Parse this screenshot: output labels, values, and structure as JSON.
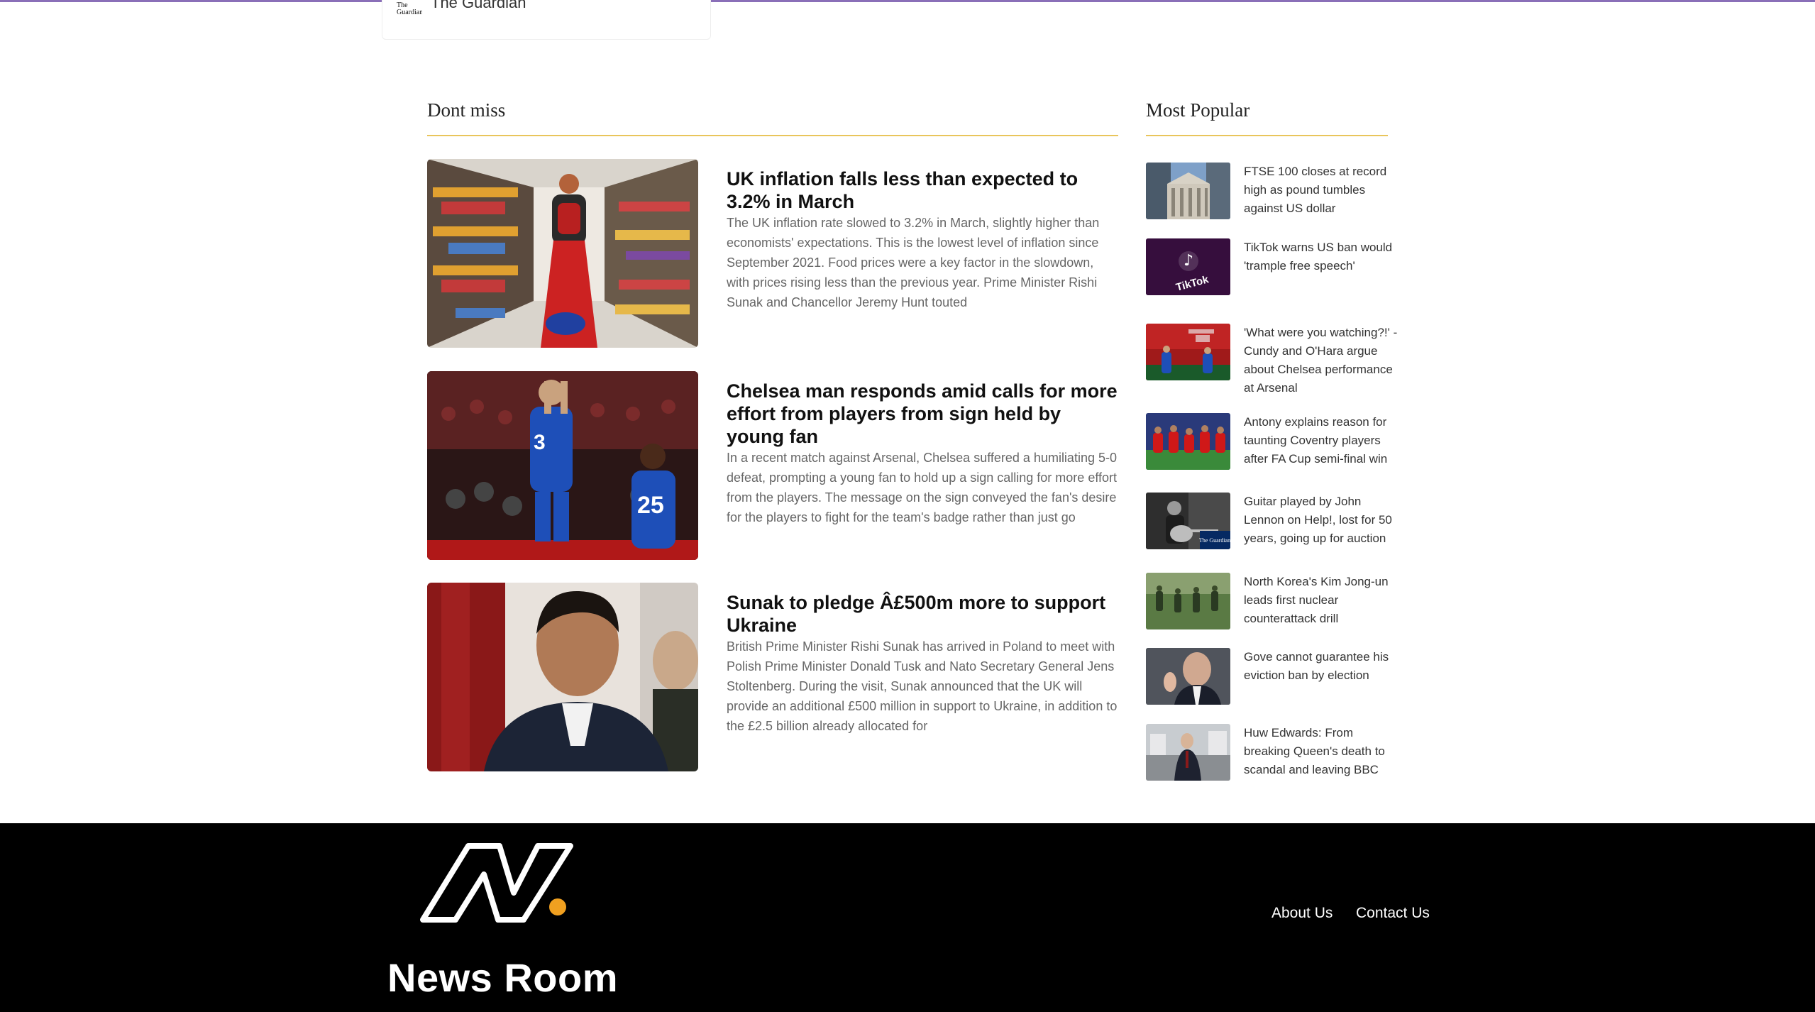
{
  "top_card": {
    "source_name": "The Guardian",
    "logo_text": "The Guardian"
  },
  "dont_miss": {
    "title": "Dont miss",
    "articles": [
      {
        "headline": "UK inflation falls less than expected to 3.2% in March",
        "summary": "The UK inflation rate slowed to 3.2% in March, slightly higher than economists' expectations. This is the lowest level of inflation since September 2021. Food prices were a key factor in the slowdown, with prices rising less than the previous year. Prime Minister Rishi Sunak and Chancellor Jeremy Hunt touted"
      },
      {
        "headline": "Chelsea man responds amid calls for more effort from players from sign held by young fan",
        "summary": "In a recent match against Arsenal, Chelsea suffered a humiliating 5-0 defeat, prompting a young fan to hold up a sign calling for more effort from the players. The message on the sign conveyed the fan's desire for the players to fight for the team's badge rather than just go",
        "jersey_numbers": [
          "3",
          "25"
        ]
      },
      {
        "headline": "Sunak to pledge Â£500m more to support Ukraine",
        "summary": "British Prime Minister Rishi Sunak has arrived in Poland to meet with Polish Prime Minister Donald Tusk and Nato Secretary General Jens Stoltenberg. During the visit, Sunak announced that the UK will provide an additional £500 million in support to Ukraine, in addition to the £2.5 billion already allocated for"
      }
    ]
  },
  "most_popular": {
    "title": "Most Popular",
    "items": [
      {
        "text": "FTSE 100 closes at record high as pound tumbles against US dollar"
      },
      {
        "text": "TikTok warns US ban would 'trample free speech'",
        "thumb_text": "TikTok"
      },
      {
        "text": "'What were you watching?!' - Cundy and O'Hara argue about Chelsea performance at Arsenal"
      },
      {
        "text": "Antony explains reason for taunting Coventry players after FA Cup semi-final win"
      },
      {
        "text": "Guitar played by John Lennon on Help!, lost for 50 years, going up for auction",
        "thumb_text": "The Guardian"
      },
      {
        "text": "North Korea's Kim Jong-un leads first nuclear counterattack drill"
      },
      {
        "text": "Gove cannot guarantee his eviction ban by election"
      },
      {
        "text": "Huw Edwards: From breaking Queen's death to scandal and leaving BBC"
      }
    ]
  },
  "footer": {
    "brand": "News Room",
    "links": [
      "About Us",
      "Contact Us"
    ]
  },
  "colors": {
    "accent_rule": "#e9c55c",
    "logo_dot": "#f0a020",
    "footer_bg": "#000000",
    "top_line": "#8a6fb8"
  }
}
